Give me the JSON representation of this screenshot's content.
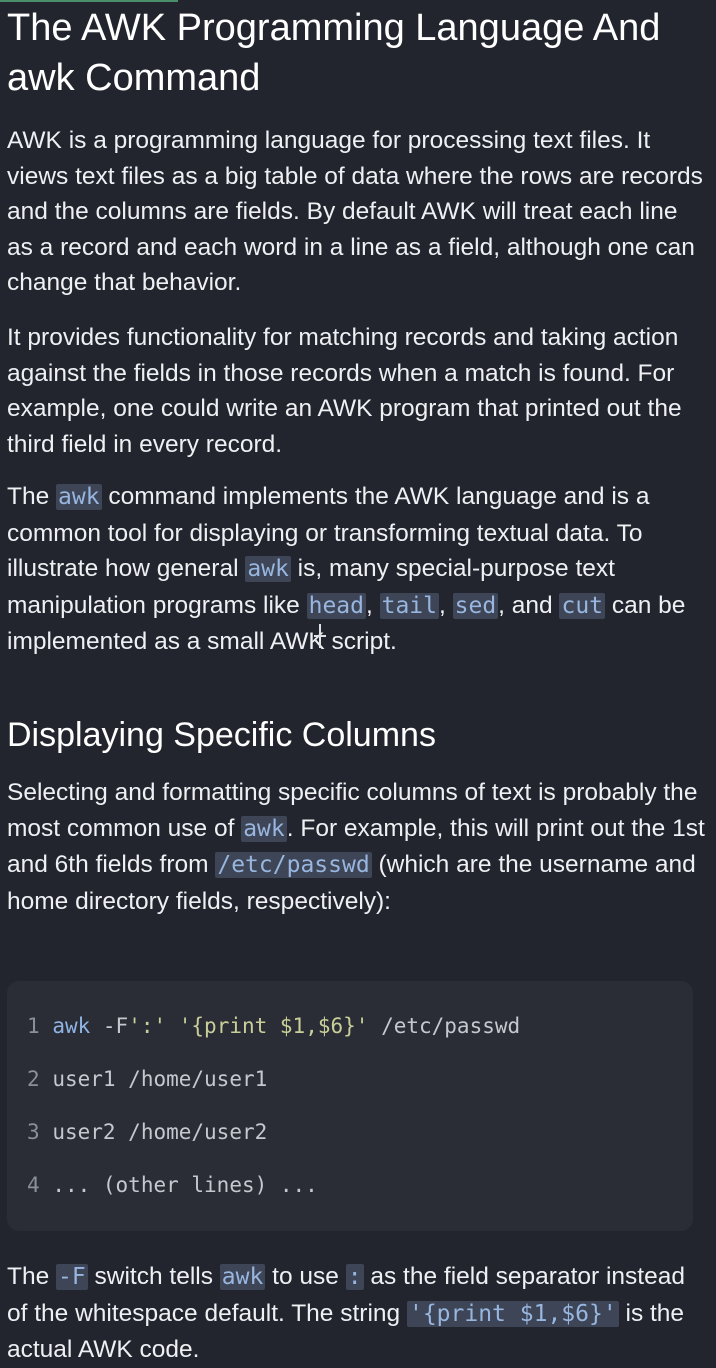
{
  "title": "The AWK Programming Language And awk Command",
  "paragraphs": {
    "p1": "AWK is a programming language for processing text files. It views text files as a big table of data where the rows are records and the columns are fields.  By default AWK will treat each line as a record and each word in a line as a field, although one can change that behavior.",
    "p2": "It provides functionality for matching records and taking action against the fields in those records when a match is found.  For example, one could write an AWK program that printed out the third field in every record.",
    "p3": {
      "t1": "The ",
      "c1": "awk",
      "t2": " command implements the AWK language and is a common tool for displaying or transforming textual data.  To illustrate how general ",
      "c2": "awk",
      "t3": " is, many special-purpose text manipulation programs like ",
      "c3": "head",
      "t4": ", ",
      "c4": "tail",
      "t5": ", ",
      "c5": "sed",
      "t6": ", and ",
      "c6": "cut",
      "t7": " can be implemented as a small AWK script."
    },
    "p4": {
      "t1": "Selecting and formatting specific columns of text is probably the most common use of ",
      "c1": "awk",
      "t2": ".  For example, this will print out the 1st and 6th fields from ",
      "c2": "/etc/passwd",
      "t3": " (which are the username and home directory fields, respectively):"
    },
    "p5": {
      "t1": "The ",
      "c1": "-F",
      "t2": " switch tells ",
      "c2": "awk",
      "t3": " to use ",
      "c3": ":",
      "t4": " as the field separator instead of the whitespace default.  The string ",
      "c4": "'{print $1,$6}'",
      "t5": " is the actual AWK code."
    }
  },
  "section_heading": "Displaying Specific Columns",
  "code_block": {
    "lines": [
      {
        "num": "1",
        "cmd": "awk",
        "flag": " -F",
        "sep": "':'",
        "prog": " '{print $1,$6}'",
        "file": " /etc/passwd"
      },
      {
        "num": "2",
        "text": "user1 /home/user1"
      },
      {
        "num": "3",
        "text": "user2 /home/user2"
      },
      {
        "num": "4",
        "text": "... (other lines) ..."
      }
    ]
  },
  "colors": {
    "background": "#22252d",
    "code_background": "#2a2d35",
    "inline_code_background": "#3d4556",
    "inline_code_text": "#98b6df",
    "accent_bar": "#4a8f6a"
  },
  "icons": {
    "cursor": "text-cursor-icon"
  }
}
